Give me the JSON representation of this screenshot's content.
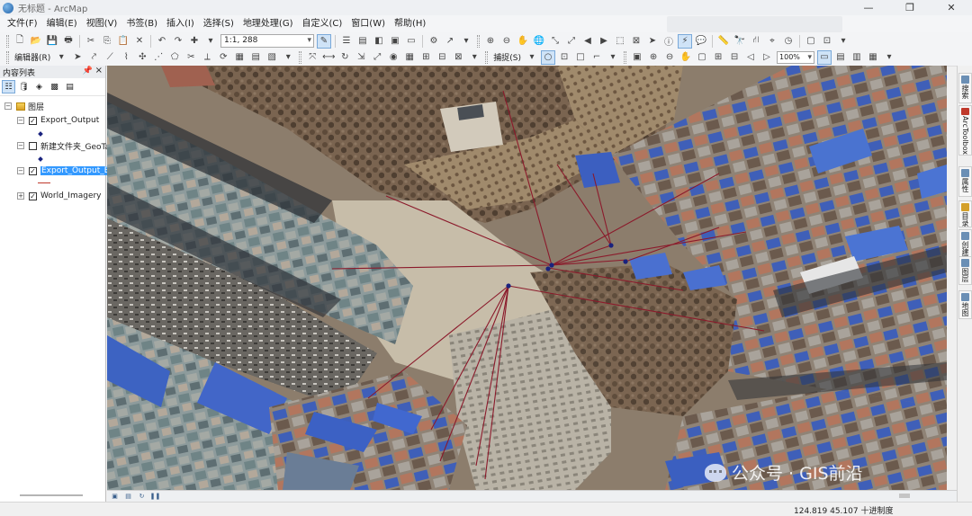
{
  "window": {
    "title": "无标题 - ArcMap",
    "controls": [
      "—",
      "❐",
      "✕"
    ]
  },
  "menu": [
    "文件(F)",
    "编辑(E)",
    "视图(V)",
    "书签(B)",
    "插入(I)",
    "选择(S)",
    "地理处理(G)",
    "自定义(C)",
    "窗口(W)",
    "帮助(H)"
  ],
  "toolbar": {
    "scale": "1:1, 288",
    "editor_label": "编辑器(R)",
    "snapping_label": "捕捉(S)",
    "zoom": "100%"
  },
  "toc": {
    "title": "内容列表",
    "root": "图层",
    "layers": [
      {
        "name": "Export_Output",
        "checked": true,
        "symbol": "point",
        "expanded": true
      },
      {
        "name": "新建文件夹_GeoTa",
        "checked": false,
        "symbol": "point",
        "expanded": true
      },
      {
        "name": "Export_Output_B",
        "checked": true,
        "symbol": "line",
        "expanded": true,
        "selected": true
      },
      {
        "name": "World_Imagery",
        "checked": true,
        "symbol": "none",
        "expanded": false
      }
    ]
  },
  "right_tabs": [
    "搜索",
    "ArcToolbox",
    "属性",
    "目录",
    "创建要素",
    "图层",
    "地图"
  ],
  "status": {
    "x": "124.819",
    "y": "45.107",
    "units": "十进制度"
  },
  "watermark": "公众号 · GIS前沿",
  "colors": {
    "line": "#8b1a2b",
    "point": "#1a237e",
    "selection": "#3399ff"
  }
}
